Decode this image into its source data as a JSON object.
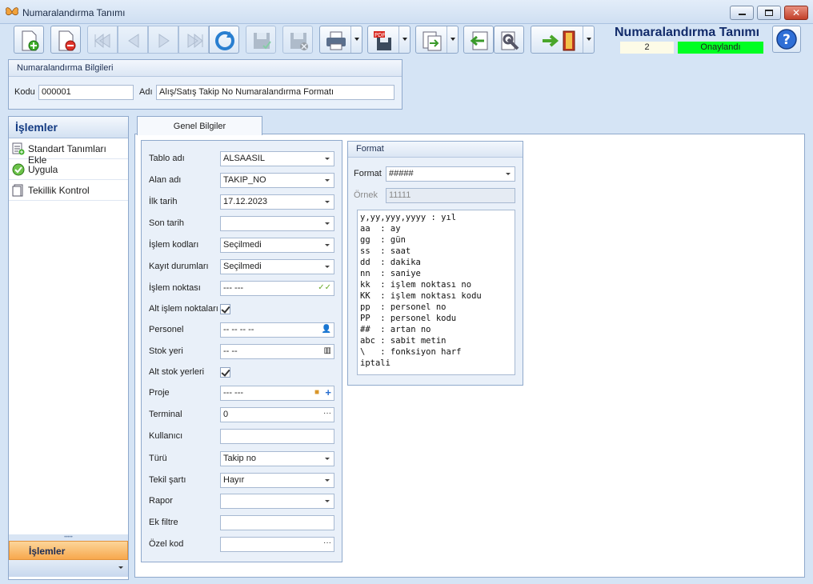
{
  "window": {
    "title": "Numaralandırma Tanımı"
  },
  "toolbar": {
    "buttons": [
      {
        "name": "new-record-button",
        "icon": "new-document-icon",
        "enabled": true
      },
      {
        "name": "delete-record-button",
        "icon": "delete-document-icon",
        "enabled": true
      },
      {
        "name": "first-record-button",
        "icon": "first-icon",
        "enabled": false
      },
      {
        "name": "previous-record-button",
        "icon": "previous-icon",
        "enabled": false
      },
      {
        "name": "next-record-button",
        "icon": "next-icon",
        "enabled": false
      },
      {
        "name": "last-record-button",
        "icon": "last-icon",
        "enabled": false
      },
      {
        "name": "refresh-button",
        "icon": "refresh-icon",
        "enabled": true
      },
      {
        "name": "save-button",
        "icon": "save-icon",
        "enabled": false
      },
      {
        "name": "cancel-save-button",
        "icon": "save-cancel-icon",
        "enabled": false
      },
      {
        "name": "print-button",
        "icon": "printer-icon",
        "enabled": true
      },
      {
        "name": "pdf-export-button",
        "icon": "pdf-icon",
        "enabled": true
      },
      {
        "name": "export-button",
        "icon": "export-icon",
        "enabled": true
      },
      {
        "name": "import-button",
        "icon": "import-icon",
        "enabled": true
      },
      {
        "name": "tools-button",
        "icon": "wrench-icon",
        "enabled": true
      },
      {
        "name": "exit-button",
        "icon": "exit-door-icon",
        "enabled": true
      }
    ]
  },
  "header": {
    "form_title": "Numaralandırma Tanımı",
    "record_no": "2",
    "status": "Onaylandı",
    "status_color": "#00ff22"
  },
  "numbering_info": {
    "group_title": "Numaralandırma Bilgileri",
    "code_label": "Kodu",
    "code_value": "000001",
    "name_label": "Adı",
    "name_value": "Alış/Satış Takip No Numaralandırma Formatı"
  },
  "actions_panel": {
    "title": "İşlemler",
    "items": [
      {
        "label": "Standart Tanımları Ekle",
        "icon": "add-list-icon"
      },
      {
        "label": "Uygula",
        "icon": "check-circle-icon"
      },
      {
        "label": "Tekillik Kontrol",
        "icon": "document-icon"
      }
    ],
    "footer_label": "İşlemler"
  },
  "tabs": [
    {
      "label": "Genel Bilgiler",
      "active": true
    }
  ],
  "general": {
    "table_name": {
      "label": "Tablo adı",
      "value": "ALSAASIL"
    },
    "field_name": {
      "label": "Alan adı",
      "value": "TAKIP_NO"
    },
    "start_date": {
      "label": "İlk tarih",
      "value": "17.12.2023"
    },
    "end_date": {
      "label": "Son tarih",
      "value": ""
    },
    "op_codes": {
      "label": "İşlem kodları",
      "value": "Seçilmedi"
    },
    "record_states": {
      "label": "Kayıt durumları",
      "value": "Seçilmedi"
    },
    "op_point": {
      "label": "İşlem noktası",
      "value": "--- ---"
    },
    "sub_op_points": {
      "label": "Alt işlem noktaları",
      "checked": true
    },
    "personnel": {
      "label": "Personel",
      "value": "-- -- -- --"
    },
    "stock_place": {
      "label": "Stok yeri",
      "value": "-- --"
    },
    "sub_stock_places": {
      "label": "Alt stok yerleri",
      "checked": true
    },
    "project": {
      "label": "Proje",
      "value": "--- ---"
    },
    "terminal": {
      "label": "Terminal",
      "value": "0"
    },
    "user": {
      "label": "Kullanıcı",
      "value": ""
    },
    "type": {
      "label": "Türü",
      "value": "Takip no"
    },
    "unique_cond": {
      "label": "Tekil şartı",
      "value": "Hayır"
    },
    "report": {
      "label": "Rapor",
      "value": ""
    },
    "extra_filter": {
      "label": "Ek filtre",
      "value": ""
    },
    "special_code": {
      "label": "Özel kod",
      "value": ""
    }
  },
  "format": {
    "group_title": "Format",
    "format_label": "Format",
    "format_value": "#####",
    "example_label": "Örnek",
    "example_value": "11111",
    "help_text": "y,yy,yyy,yyyy : yıl\naa  : ay\ngg  : gün\nss  : saat\ndd  : dakika\nnn  : saniye\nkk  : işlem noktası no\nKK  : işlem noktası kodu\npp  : personel no\nPP  : personel kodu\n##  : artan no\nabc : sabit metin\n\\   : fonksiyon harf\niptali"
  }
}
